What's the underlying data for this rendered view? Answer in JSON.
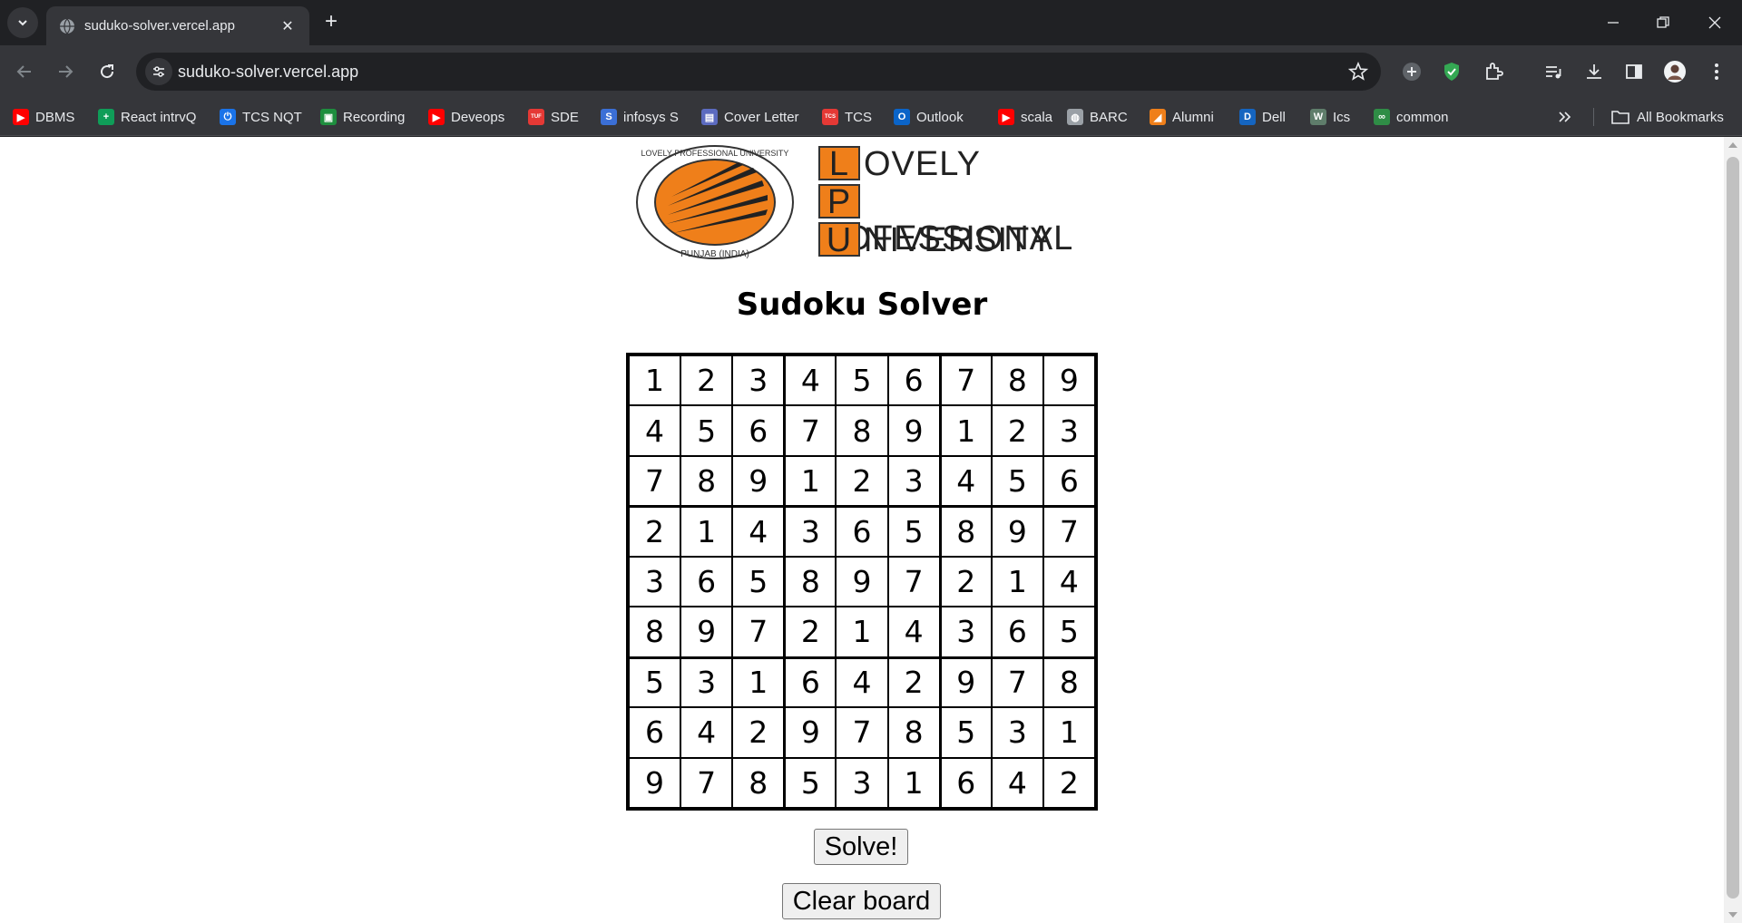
{
  "browser": {
    "tab_title": "suduko-solver.vercel.app",
    "url": "suduko-solver.vercel.app",
    "all_bookmarks_label": "All Bookmarks",
    "bookmarks": [
      {
        "label": "DBMS",
        "icon": "youtube-icon",
        "color": "#ff0000"
      },
      {
        "label": "React intrvQ",
        "icon": "plus-square-icon",
        "color": "#0f9d58"
      },
      {
        "label": "TCS NQT",
        "icon": "power-icon",
        "color": "#1a73e8"
      },
      {
        "label": "Recording",
        "icon": "classroom-icon",
        "color": "#1e8e3e"
      },
      {
        "label": "Deveops",
        "icon": "youtube-icon",
        "color": "#ff0000"
      },
      {
        "label": "SDE",
        "icon": "tuf-icon",
        "color": "#e53935"
      },
      {
        "label": "infosys S",
        "icon": "s-icon",
        "color": "#3b6fd6"
      },
      {
        "label": "Cover Letter",
        "icon": "doc-icon",
        "color": "#5c6bc0"
      },
      {
        "label": "TCS",
        "icon": "tcs-icon",
        "color": "#e53935"
      },
      {
        "label": "Outlook",
        "icon": "outlook-icon",
        "color": "#0a64c8"
      },
      {
        "label": "scala",
        "icon": "youtube-icon",
        "color": "#ff0000"
      },
      {
        "label": "BARC",
        "icon": "globe-icon",
        "color": "#9aa0a6"
      },
      {
        "label": "Alumni",
        "icon": "lpu-icon",
        "color": "#ef7f1a"
      },
      {
        "label": "Dell",
        "icon": "dell-icon",
        "color": "#1565c0"
      },
      {
        "label": "Ics",
        "icon": "w-icon",
        "color": "#5f7d6b"
      },
      {
        "label": "common",
        "icon": "gfg-icon",
        "color": "#2f8d46"
      }
    ]
  },
  "page": {
    "logo": {
      "seal_text_top": "LOVELY PROFESSIONAL UNIVERSITY",
      "seal_text_bottom": "PUNJAB (INDIA)",
      "words": [
        {
          "letter": "L",
          "rest": "OVELY"
        },
        {
          "letter": "P",
          "rest": "ROFESSIONAL"
        },
        {
          "letter": "U",
          "rest": "NIVERSITY"
        }
      ],
      "accent_color": "#ef7f1a"
    },
    "title": "Sudoku Solver",
    "board": [
      [
        1,
        2,
        3,
        4,
        5,
        6,
        7,
        8,
        9
      ],
      [
        4,
        5,
        6,
        7,
        8,
        9,
        1,
        2,
        3
      ],
      [
        7,
        8,
        9,
        1,
        2,
        3,
        4,
        5,
        6
      ],
      [
        2,
        1,
        4,
        3,
        6,
        5,
        8,
        9,
        7
      ],
      [
        3,
        6,
        5,
        8,
        9,
        7,
        2,
        1,
        4
      ],
      [
        8,
        9,
        7,
        2,
        1,
        4,
        3,
        6,
        5
      ],
      [
        5,
        3,
        1,
        6,
        4,
        2,
        9,
        7,
        8
      ],
      [
        6,
        4,
        2,
        9,
        7,
        8,
        5,
        3,
        1
      ],
      [
        9,
        7,
        8,
        5,
        3,
        1,
        6,
        4,
        2
      ]
    ],
    "solve_label": "Solve!",
    "clear_label": "Clear board"
  }
}
